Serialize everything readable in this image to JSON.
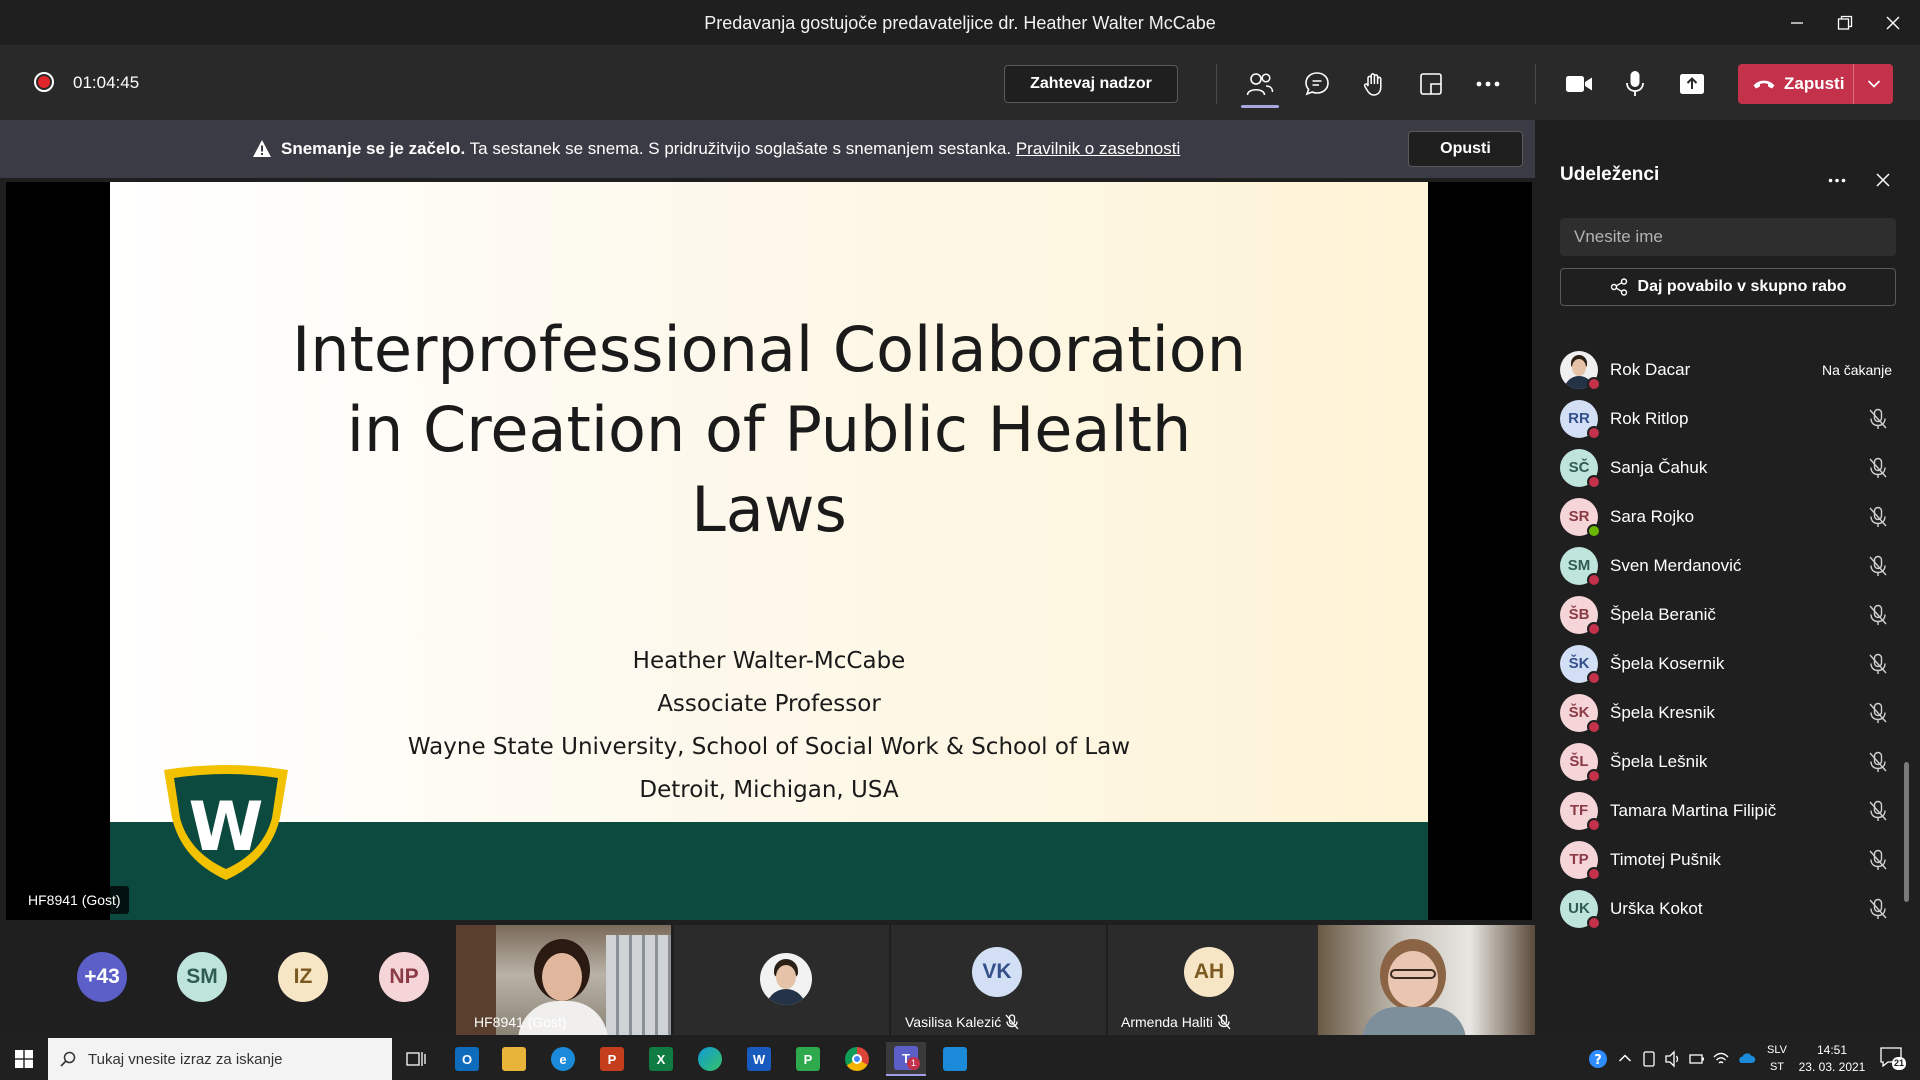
{
  "window": {
    "title": "Predavanja gostujoče predavateljice dr. Heather Walter McCabe"
  },
  "meeting": {
    "timer": "01:04:45",
    "request_control": "Zahtevaj nadzor",
    "leave_label": "Zapusti"
  },
  "banner": {
    "bold": "Snemanje se je začelo.",
    "text": " Ta sestanek se snema. S pridružitvijo soglašate s snemanjem sestanka. ",
    "link": "Pravilnik o zasebnosti",
    "dismiss": "Opusti"
  },
  "slide": {
    "title_lines": [
      "Interprofessional Collaboration",
      "in Creation of Public Health",
      "Laws"
    ],
    "subtitle_lines": [
      "Heather Walter-McCabe",
      "Associate Professor",
      "Wayne State University, School of Social Work & School of Law",
      "Detroit, Michigan, USA"
    ],
    "logo_letter": "W",
    "speaker_tag": "HF8941 (Gost)"
  },
  "strip": {
    "more_count": "+43",
    "avatars": [
      {
        "initials": "SM",
        "bg": "#bfe4dc",
        "fg": "#2e5c53"
      },
      {
        "initials": "IZ",
        "bg": "#f6e6c6",
        "fg": "#7a5a20"
      },
      {
        "initials": "NP",
        "bg": "#f5d5d8",
        "fg": "#8a3b45"
      }
    ],
    "tiles": [
      {
        "name": "HF8941 (Gost)",
        "kind": "video"
      },
      {
        "name": "",
        "kind": "photo"
      },
      {
        "name": "Vasilisa Kalezić",
        "initials": "VK",
        "bg": "#d3dff5",
        "fg": "#33508a",
        "muted": true
      },
      {
        "name": "Armenda Haliti",
        "initials": "AH",
        "bg": "#f6e6c6",
        "fg": "#7a5a20",
        "muted": true
      },
      {
        "name": "",
        "kind": "video2"
      }
    ]
  },
  "panel": {
    "title": "Udeleženci",
    "search_placeholder": "Vnesite ime",
    "share_invite": "Daj povabilo v skupno rabo",
    "participants": [
      {
        "name": "Rok Dacar",
        "initials": "",
        "photo": true,
        "status": "#c4314b",
        "right": "Na čakanje"
      },
      {
        "name": "Rok Ritlop",
        "initials": "RR",
        "bg": "#d3dff5",
        "fg": "#33508a",
        "status": "#c4314b"
      },
      {
        "name": "Sanja Čahuk",
        "initials": "SČ",
        "bg": "#bfe4dc",
        "fg": "#2e5c53",
        "status": "#c4314b"
      },
      {
        "name": "Sara Rojko",
        "initials": "SR",
        "bg": "#f5d5d8",
        "fg": "#8a3b45",
        "status": "#6bb700"
      },
      {
        "name": "Sven Merdanović",
        "initials": "SM",
        "bg": "#bfe4dc",
        "fg": "#2e5c53",
        "status": "#c4314b"
      },
      {
        "name": "Špela Beranič",
        "initials": "ŠB",
        "bg": "#f5d5d8",
        "fg": "#8a3b45",
        "status": "#c4314b"
      },
      {
        "name": "Špela Kosernik",
        "initials": "ŠK",
        "bg": "#d3dff5",
        "fg": "#33508a",
        "status": "#c4314b"
      },
      {
        "name": "Špela Kresnik",
        "initials": "ŠK",
        "bg": "#f5d5d8",
        "fg": "#8a3b45",
        "status": "#c4314b"
      },
      {
        "name": "Špela Lešnik",
        "initials": "ŠL",
        "bg": "#f5d5d8",
        "fg": "#8a3b45",
        "status": "#c4314b"
      },
      {
        "name": "Tamara Martina Filipič",
        "initials": "TF",
        "bg": "#f5d5d8",
        "fg": "#8a3b45",
        "status": "#c4314b"
      },
      {
        "name": "Timotej Pušnik",
        "initials": "TP",
        "bg": "#f5d5d8",
        "fg": "#8a3b45",
        "status": "#c4314b"
      },
      {
        "name": "Urška Kokot",
        "initials": "UK",
        "bg": "#bfe4dc",
        "fg": "#2e5c53",
        "status": "#c4314b"
      }
    ]
  },
  "taskbar": {
    "search_placeholder": "Tukaj vnesite izraz za iskanje",
    "lang_line1": "SLV",
    "lang_line2": "ST",
    "time": "14:51",
    "date": "23. 03. 2021",
    "notif_count": "21",
    "teams_badge": "1"
  },
  "colors": {
    "accent": "#a6a7dc",
    "leave": "#c4314b",
    "slide_band": "#0c4a3f",
    "logo_gold": "#f2c100"
  }
}
